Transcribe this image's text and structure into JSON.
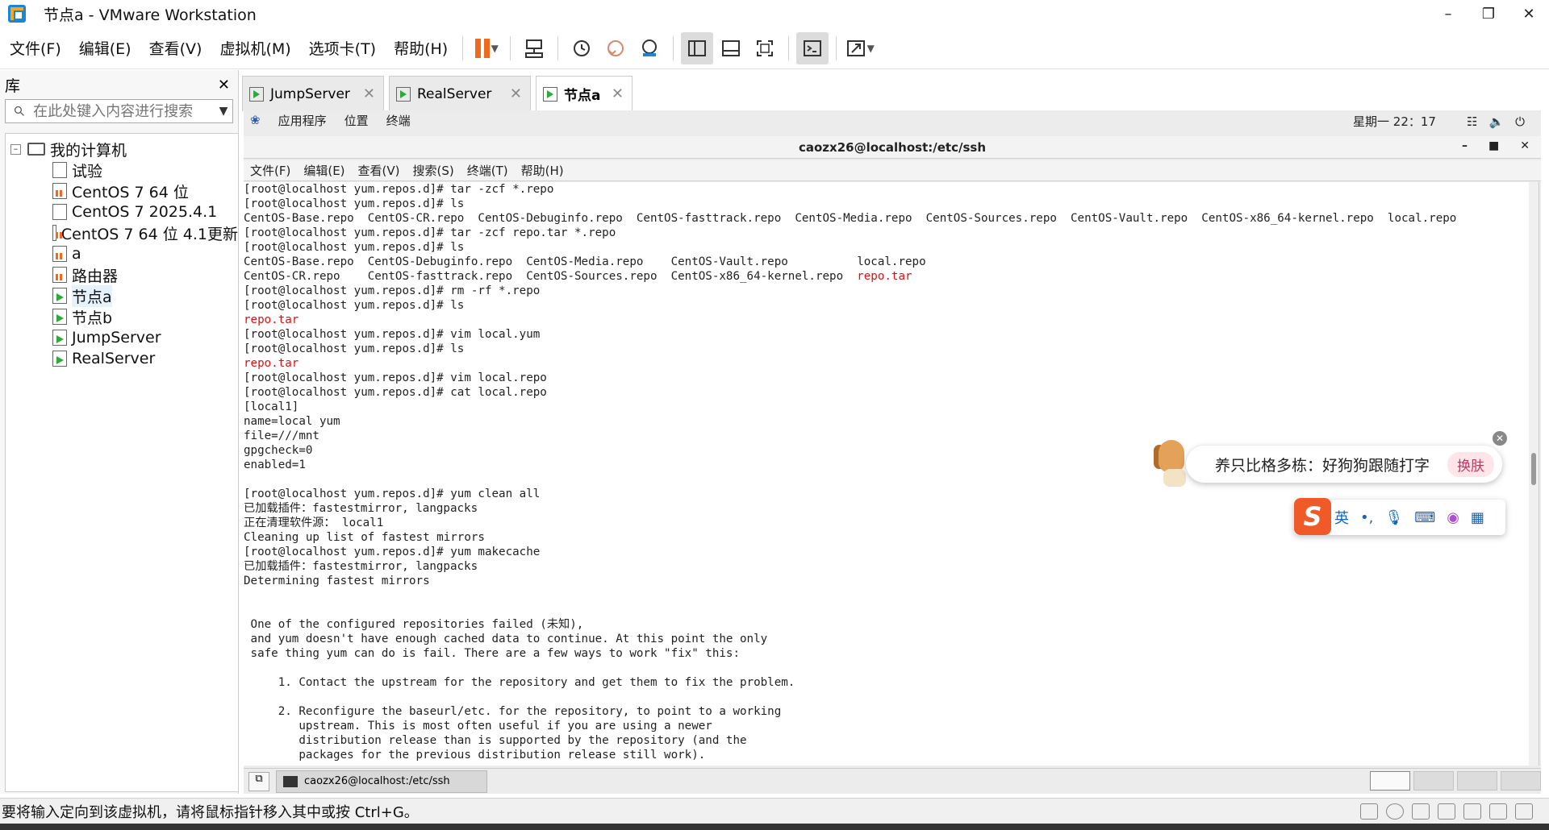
{
  "window": {
    "title": "节点a - VMware Workstation"
  },
  "menu": {
    "items": [
      "文件(F)",
      "编辑(E)",
      "查看(V)",
      "虚拟机(M)",
      "选项卡(T)",
      "帮助(H)"
    ]
  },
  "library": {
    "title": "库",
    "search_placeholder": "在此处键入内容进行搜索",
    "root": "我的计算机",
    "items": [
      "试验",
      "CentOS 7 64 位",
      "CentOS 7 2025.4.1",
      "CentOS 7 64 位 4.1更新",
      "a",
      "路由器",
      "节点a",
      "节点b",
      "JumpServer",
      "RealServer"
    ]
  },
  "tabs": [
    "JumpServer",
    "RealServer",
    "节点a"
  ],
  "gnome": {
    "apps": "应用程序",
    "places": "位置",
    "terminal": "终端",
    "clock": "星期一 22：17"
  },
  "terminal": {
    "title": "caozx26@localhost:/etc/ssh",
    "menu": [
      "文件(F)",
      "编辑(E)",
      "查看(V)",
      "搜索(S)",
      "终端(T)",
      "帮助(H)"
    ],
    "lines": [
      {
        "t": "[root@localhost yum.repos.d]# tar -zcf *.repo",
        "c": ""
      },
      {
        "t": "[root@localhost yum.repos.d]# ls",
        "c": ""
      },
      {
        "t": "CentOS-Base.repo  CentOS-CR.repo  CentOS-Debuginfo.repo  CentOS-fasttrack.repo  CentOS-Media.repo  CentOS-Sources.repo  CentOS-Vault.repo  CentOS-x86_64-kernel.repo  local.repo",
        "c": ""
      },
      {
        "t": "[root@localhost yum.repos.d]# tar -zcf repo.tar *.repo",
        "c": ""
      },
      {
        "t": "[root@localhost yum.repos.d]# ls",
        "c": ""
      },
      {
        "t": "CentOS-Base.repo  CentOS-Debuginfo.repo  CentOS-Media.repo    CentOS-Vault.repo          local.repo",
        "c": ""
      },
      {
        "t": "CentOS-CR.repo    CentOS-fasttrack.repo  CentOS-Sources.repo  CentOS-x86_64-kernel.repo  repo.tar",
        "c": "mixed"
      },
      {
        "t": "[root@localhost yum.repos.d]# rm -rf *.repo",
        "c": ""
      },
      {
        "t": "[root@localhost yum.repos.d]# ls",
        "c": ""
      },
      {
        "t": "repo.tar",
        "c": "red"
      },
      {
        "t": "[root@localhost yum.repos.d]# vim local.yum",
        "c": ""
      },
      {
        "t": "[root@localhost yum.repos.d]# ls",
        "c": ""
      },
      {
        "t": "repo.tar",
        "c": "red"
      },
      {
        "t": "[root@localhost yum.repos.d]# vim local.repo",
        "c": ""
      },
      {
        "t": "[root@localhost yum.repos.d]# cat local.repo",
        "c": ""
      },
      {
        "t": "[local1]",
        "c": ""
      },
      {
        "t": "name=local yum",
        "c": ""
      },
      {
        "t": "file=///mnt",
        "c": ""
      },
      {
        "t": "gpgcheck=0",
        "c": ""
      },
      {
        "t": "enabled=1",
        "c": ""
      },
      {
        "t": "",
        "c": ""
      },
      {
        "t": "[root@localhost yum.repos.d]# yum clean all",
        "c": ""
      },
      {
        "t": "已加载插件：fastestmirror, langpacks",
        "c": ""
      },
      {
        "t": "正在清理软件源： local1",
        "c": ""
      },
      {
        "t": "Cleaning up list of fastest mirrors",
        "c": ""
      },
      {
        "t": "[root@localhost yum.repos.d]# yum makecache",
        "c": ""
      },
      {
        "t": "已加载插件：fastestmirror, langpacks",
        "c": ""
      },
      {
        "t": "Determining fastest mirrors",
        "c": ""
      },
      {
        "t": "",
        "c": ""
      },
      {
        "t": "",
        "c": ""
      },
      {
        "t": " One of the configured repositories failed (未知),",
        "c": ""
      },
      {
        "t": " and yum doesn't have enough cached data to continue. At this point the only",
        "c": ""
      },
      {
        "t": " safe thing yum can do is fail. There are a few ways to work \"fix\" this:",
        "c": ""
      },
      {
        "t": "",
        "c": ""
      },
      {
        "t": "     1. Contact the upstream for the repository and get them to fix the problem.",
        "c": ""
      },
      {
        "t": "",
        "c": ""
      },
      {
        "t": "     2. Reconfigure the baseurl/etc. for the repository, to point to a working",
        "c": ""
      },
      {
        "t": "        upstream. This is most often useful if you are using a newer",
        "c": ""
      },
      {
        "t": "        distribution release than is supported by the repository (and the",
        "c": ""
      },
      {
        "t": "        packages for the previous distribution release still work).",
        "c": ""
      }
    ]
  },
  "taskbar": {
    "task": "caozx26@localhost:/etc/ssh"
  },
  "ime": {
    "bubble_text": "养只比格多栋：好狗狗跟随打字",
    "skin_button": "换肤",
    "mode": "英"
  },
  "statusbar": {
    "text": "要将输入定向到该虚拟机，请将鼠标指针移入其中或按 Ctrl+G。"
  }
}
